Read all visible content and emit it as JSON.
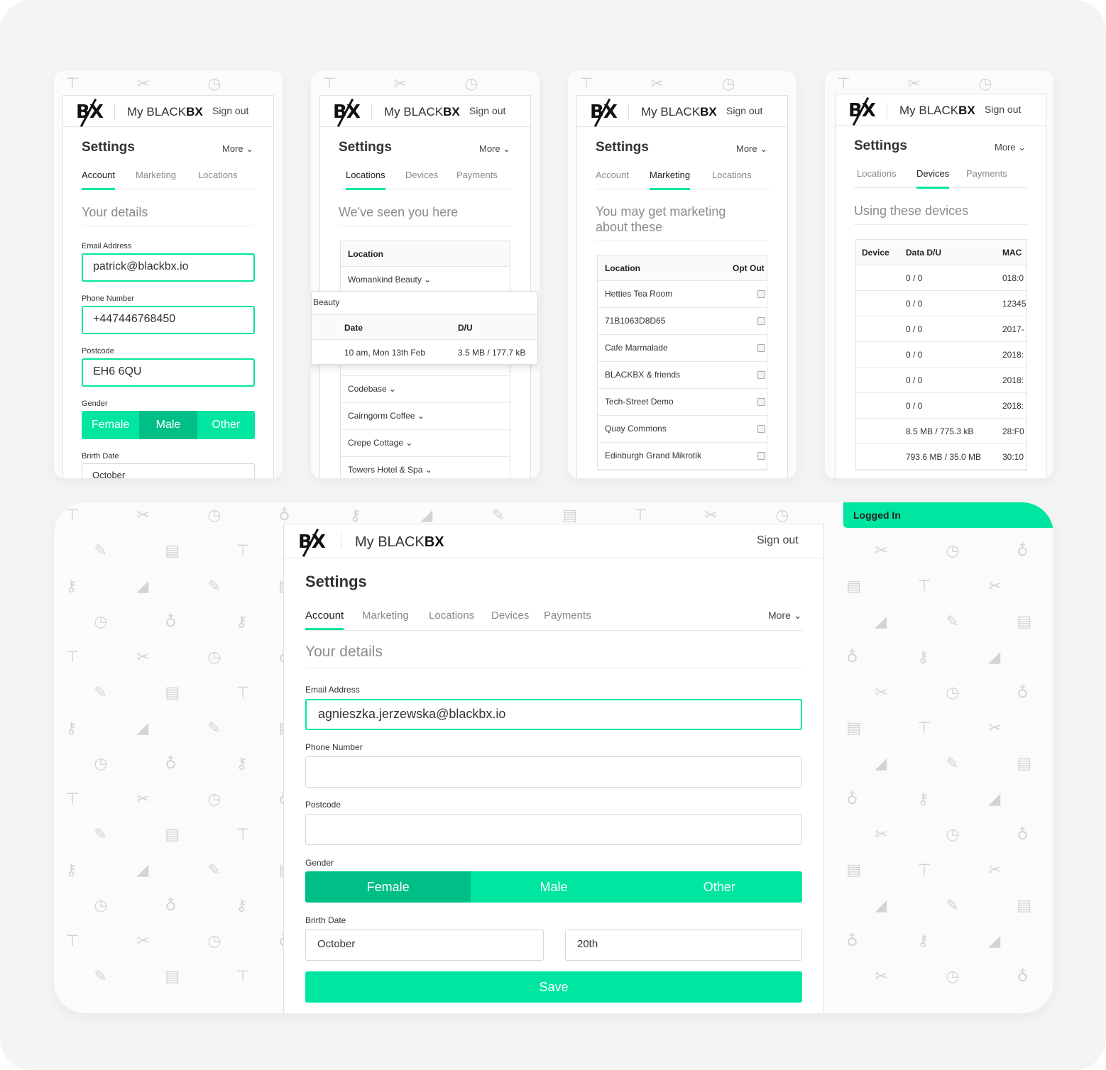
{
  "brand": {
    "logo": "BX",
    "prefix": "My BLACK",
    "suffix": "BX",
    "signout": "Sign out"
  },
  "common": {
    "settings": "Settings",
    "more": "More ⌄"
  },
  "card1": {
    "tabs": [
      "Account",
      "Marketing",
      "Locations"
    ],
    "subtitle": "Your details",
    "email_label": "Email Address",
    "email": "patrick@blackbx.io",
    "phone_label": "Phone Number",
    "phone": "+447446768450",
    "postcode_label": "Postcode",
    "postcode": "EH6 6QU",
    "gender_label": "Gender",
    "gender_options": [
      "Female",
      "Male",
      "Other"
    ],
    "birth_label": "Brirth Date",
    "birth_month": "October"
  },
  "card2": {
    "tabs": [
      "Locations",
      "Devices",
      "Payments"
    ],
    "subtitle": "We've seen you here",
    "col_location": "Location",
    "rows": [
      "Womankind Beauty ⌄",
      "Codebase ⌄",
      "Cairngorm Coffee ⌄",
      "Crepe Cottage ⌄",
      "Towers Hotel & Spa ⌄"
    ],
    "popover": {
      "title": "Beauty",
      "col_date": "Date",
      "col_du": "D/U",
      "date": "10 am, Mon 13th Feb",
      "du": "3.5 MB / 177.7 kB"
    }
  },
  "card3": {
    "tabs": [
      "Account",
      "Marketing",
      "Locations"
    ],
    "subtitle_line1": "You may get marketing",
    "subtitle_line2": "about these",
    "col_location": "Location",
    "col_optout": "Opt Out",
    "rows": [
      "Hetties Tea Room",
      "71B1063D8D65",
      "Cafe Marmalade",
      "BLACKBX & friends",
      "Tech-Street Demo",
      "Quay Commons",
      "Edinburgh Grand Mikrotik"
    ]
  },
  "card4": {
    "tabs": [
      "Locations",
      "Devices",
      "Payments"
    ],
    "subtitle": "Using these devices",
    "col_device": "Device",
    "col_data": "Data D/U",
    "col_mac": "MAC",
    "rows": [
      {
        "data": "0 / 0",
        "mac": "018:0"
      },
      {
        "data": "0 / 0",
        "mac": "12345"
      },
      {
        "data": "0 / 0",
        "mac": "2017-"
      },
      {
        "data": "0 / 0",
        "mac": "2018:"
      },
      {
        "data": "0 / 0",
        "mac": "2018:"
      },
      {
        "data": "0 / 0",
        "mac": "2018:"
      },
      {
        "data": "8.5 MB / 775.3 kB",
        "mac": "28:F0"
      },
      {
        "data": "793.6 MB / 35.0 MB",
        "mac": "30:10"
      }
    ]
  },
  "big": {
    "badge": "Logged In",
    "tabs": [
      "Account",
      "Marketing",
      "Locations",
      "Devices",
      "Payments"
    ],
    "subtitle": "Your details",
    "email_label": "Email Address",
    "email": "agnieszka.jerzewska@blackbx.io",
    "phone_label": "Phone Number",
    "postcode_label": "Postcode",
    "gender_label": "Gender",
    "gender_options": [
      "Female",
      "Male",
      "Other"
    ],
    "birth_label": "Brirth Date",
    "birth_month": "October",
    "birth_day": "20th",
    "save": "Save"
  },
  "colors": {
    "accent": "#00e6a0",
    "accent_dark": "#00bf86"
  },
  "pattern_icons": [
    "shower-icon",
    "tools-icon",
    "clock-icon",
    "bulb-icon",
    "key-icon",
    "hairdryer-icon",
    "brush-icon",
    "train-icon"
  ]
}
